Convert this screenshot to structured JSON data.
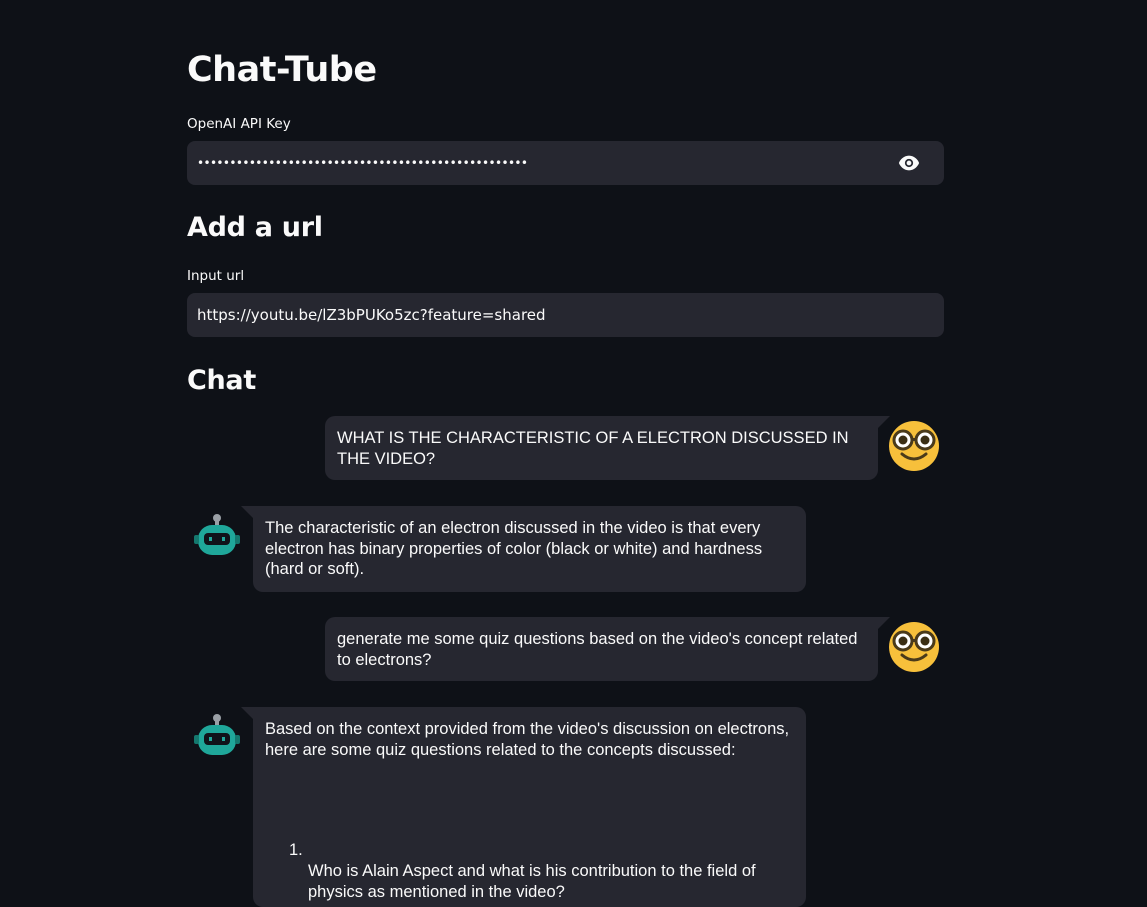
{
  "app": {
    "title": "Chat-Tube"
  },
  "api_key": {
    "label": "OpenAI API Key",
    "value": "•••••••••••••••••••••••••••••••••••••••••••••••••••",
    "toggle_icon": "eye-icon"
  },
  "url_section": {
    "heading": "Add a url",
    "label": "Input url",
    "value": "https://youtu.be/lZ3bPUKo5zc?feature=shared"
  },
  "chat": {
    "heading": "Chat",
    "messages": [
      {
        "role": "user",
        "avatar": "nerd-face-icon",
        "text": "WHAT IS THE CHARACTERISTIC OF A ELECTRON DISCUSSED IN THE VIDEO?"
      },
      {
        "role": "bot",
        "avatar": "robot-icon",
        "text": "The characteristic of an electron discussed in the video is that every electron has binary properties of color (black or white) and hardness (hard or soft)."
      },
      {
        "role": "user",
        "avatar": "nerd-face-icon",
        "text": "generate me some quiz questions based on the video's concept related to electrons?"
      },
      {
        "role": "bot",
        "avatar": "robot-icon",
        "text": "Based on the context provided from the video's discussion on electrons, here are some quiz questions related to the concepts discussed:",
        "list": [
          {
            "number": "1.",
            "text": "Who is Alain Aspect and what is his contribution to the field of physics as mentioned in the video?"
          }
        ]
      }
    ]
  },
  "colors": {
    "background": "#0e1117",
    "input_bg": "#262730",
    "text": "#fafafa",
    "user_avatar": "#f7c03b",
    "bot_avatar": "#1fa79a"
  }
}
